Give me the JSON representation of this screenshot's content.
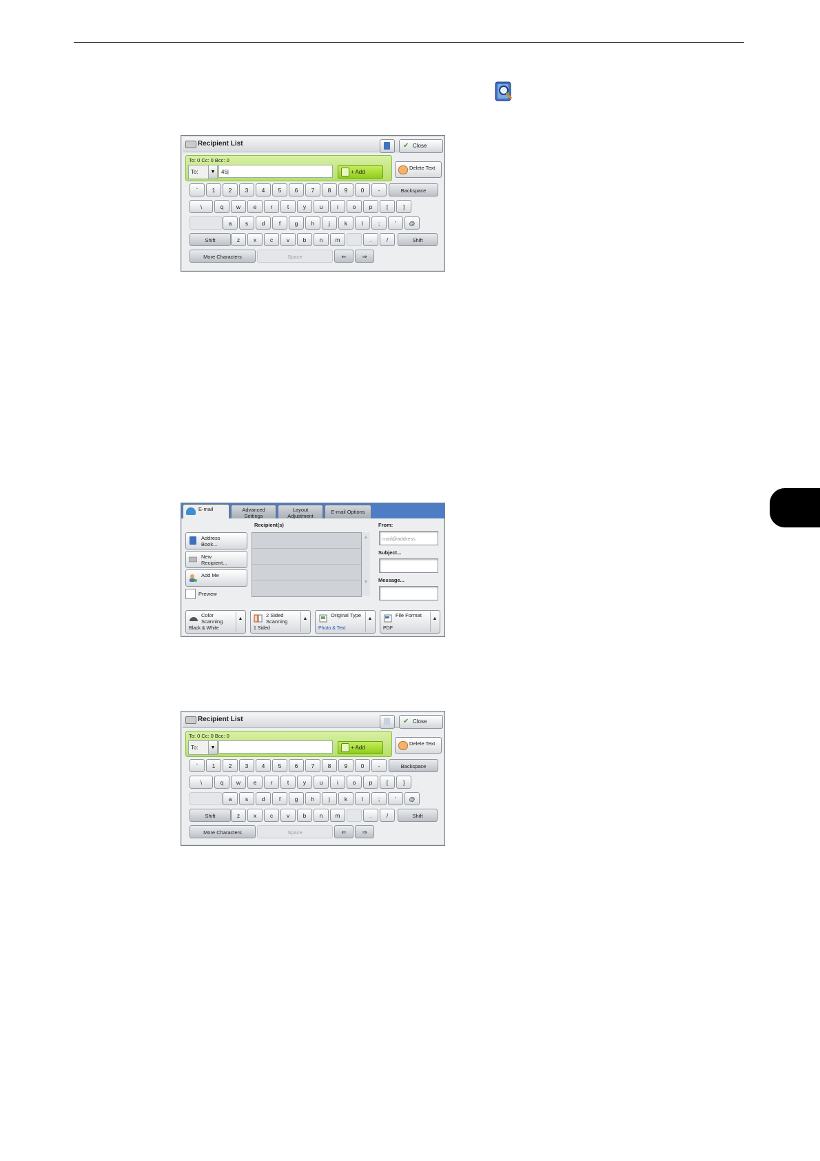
{
  "panel1": {
    "title": "Recipient List",
    "close_label": "Close",
    "counts": "To: 0  Cc: 0  Bcc: 0",
    "to_label": "To:",
    "input_value": "45|",
    "add_label": "+ Add",
    "delete_label": "Delete Text"
  },
  "panel3": {
    "title": "Recipient List",
    "close_label": "Close",
    "counts": "To: 0  Cc: 0  Bcc: 0",
    "to_label": "To:",
    "input_value": "",
    "add_label": "+ Add",
    "delete_label": "Delete Text"
  },
  "keyboard": {
    "row1": [
      "`",
      "1",
      "2",
      "3",
      "4",
      "5",
      "6",
      "7",
      "8",
      "9",
      "0",
      "-"
    ],
    "backspace": "Backspace",
    "row2": [
      "\\",
      "q",
      "w",
      "e",
      "r",
      "t",
      "y",
      "u",
      "i",
      "o",
      "p",
      "[",
      "]"
    ],
    "row3": [
      "a",
      "s",
      "d",
      "f",
      "g",
      "h",
      "j",
      "k",
      "l",
      ";",
      "'",
      "@"
    ],
    "shift": "Shift",
    "row4": [
      "z",
      "x",
      "c",
      "v",
      "b",
      "n",
      "m"
    ],
    "row4b": [
      ".",
      "/"
    ],
    "more": "More Characters",
    "space": "Space",
    "left_arrow": "⇐",
    "right_arrow": "⇒"
  },
  "email": {
    "tabs": [
      "E-mail",
      "Advanced\nSettings",
      "Layout\nAdjustment",
      "E-mail Options"
    ],
    "recipients_label": "Recipient(s)",
    "address_book": "Address\nBook...",
    "new_recipient": "New\nRecipient...",
    "add_me": "Add Me",
    "preview": "Preview",
    "from_label": "From:",
    "from_value": "mail@address",
    "subject_label": "Subject...",
    "message_label": "Message...",
    "features": [
      {
        "title": "Color\nScanning",
        "value": "Black & White"
      },
      {
        "title": "2 Sided\nScanning",
        "value": "1 Sided"
      },
      {
        "title": "Original Type",
        "value": "Photo & Text"
      },
      {
        "title": "File Format",
        "value": "PDF"
      }
    ]
  },
  "colors": {
    "accent_green": "#9ad83a",
    "tab_blue": "#4f7dc5",
    "link_blue": "#2a58b0"
  }
}
